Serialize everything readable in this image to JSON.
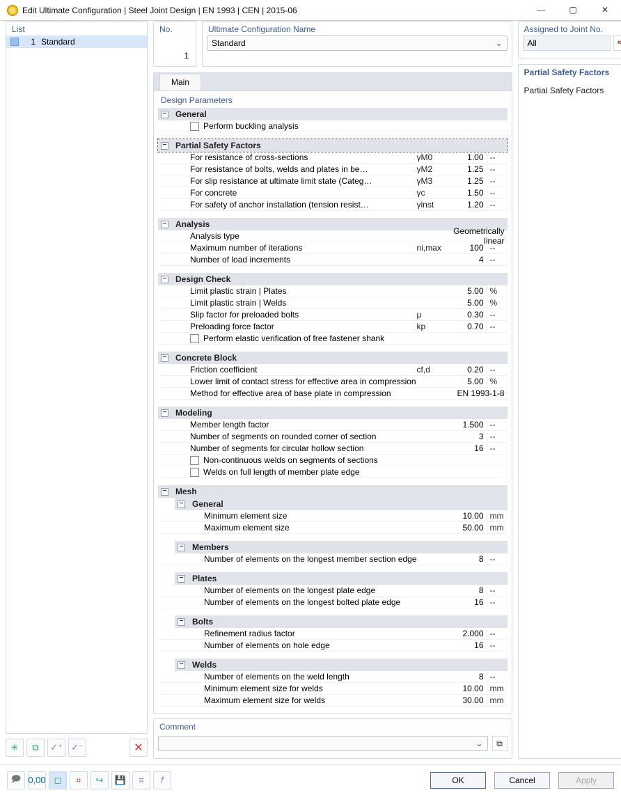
{
  "window": {
    "title": "Edit Ultimate Configuration | Steel Joint Design | EN 1993 | CEN | 2015-06"
  },
  "sidebar": {
    "header": "List",
    "items": [
      {
        "index": "1",
        "name": "Standard"
      }
    ]
  },
  "top": {
    "no_label": "No.",
    "no_value": "1",
    "name_label": "Ultimate Configuration Name",
    "name_value": "Standard",
    "assigned_label": "Assigned to Joint No.",
    "assigned_value": "All"
  },
  "tabs": {
    "main": "Main"
  },
  "designparams_label": "Design Parameters",
  "general": {
    "header": "General",
    "buckling": "Perform buckling analysis"
  },
  "psf": {
    "header": "Partial Safety Factors",
    "rows": [
      {
        "lbl": "For resistance of cross-sections",
        "sym": "γM0",
        "val": "1.00",
        "unit": "--"
      },
      {
        "lbl": "For resistance of bolts, welds and plates in be…",
        "sym": "γM2",
        "val": "1.25",
        "unit": "--"
      },
      {
        "lbl": "For slip resistance at ultimate limit state (Categ…",
        "sym": "γM3",
        "val": "1.25",
        "unit": "--"
      },
      {
        "lbl": "For concrete",
        "sym": "γc",
        "val": "1.50",
        "unit": "--"
      },
      {
        "lbl": "For safety of anchor installation (tension resist…",
        "sym": "γinst",
        "val": "1.20",
        "unit": "--"
      }
    ]
  },
  "analysis": {
    "header": "Analysis",
    "rows": [
      {
        "lbl": "Analysis type",
        "sym": "",
        "val": "",
        "wide": "Geometrically linear"
      },
      {
        "lbl": "Maximum number of iterations",
        "sym": "ni,max",
        "val": "100",
        "unit": "--"
      },
      {
        "lbl": "Number of load increments",
        "sym": "",
        "val": "4",
        "unit": "--"
      }
    ]
  },
  "designcheck": {
    "header": "Design Check",
    "rows": [
      {
        "lbl": "Limit plastic strain | Plates",
        "sym": "",
        "val": "5.00",
        "unit": "%"
      },
      {
        "lbl": "Limit plastic strain | Welds",
        "sym": "",
        "val": "5.00",
        "unit": "%"
      },
      {
        "lbl": "Slip factor for preloaded bolts",
        "sym": "μ",
        "val": "0.30",
        "unit": "--"
      },
      {
        "lbl": "Preloading force factor",
        "sym": "kp",
        "val": "0.70",
        "unit": "--"
      }
    ],
    "elastic_check": "Perform elastic verification of free fastener shank"
  },
  "concrete": {
    "header": "Concrete Block",
    "rows": [
      {
        "lbl": "Friction coefficient",
        "sym": "cf,d",
        "val": "0.20",
        "unit": "--"
      },
      {
        "lbl": "Lower limit of contact stress for effective area in compression",
        "sym": "",
        "val": "5.00",
        "unit": "%"
      },
      {
        "lbl": "Method for effective area of base plate in compression",
        "sym": "",
        "val": "",
        "wide": "EN 1993-1-8"
      }
    ]
  },
  "modeling": {
    "header": "Modeling",
    "rows": [
      {
        "lbl": "Member length factor",
        "sym": "",
        "val": "1.500",
        "unit": "--"
      },
      {
        "lbl": "Number of segments on rounded corner of section",
        "sym": "",
        "val": "3",
        "unit": "--"
      },
      {
        "lbl": "Number of segments for circular hollow section",
        "sym": "",
        "val": "16",
        "unit": "--"
      }
    ],
    "check1": "Non-continuous welds on segments of sections",
    "check2": "Welds on full length of member plate edge"
  },
  "mesh": {
    "header": "Mesh",
    "general": {
      "header": "General",
      "rows": [
        {
          "lbl": "Minimum element size",
          "val": "10.00",
          "unit": "mm"
        },
        {
          "lbl": "Maximum element size",
          "val": "50.00",
          "unit": "mm"
        }
      ]
    },
    "members": {
      "header": "Members",
      "rows": [
        {
          "lbl": "Number of elements on the longest member section edge",
          "val": "8",
          "unit": "--"
        }
      ]
    },
    "plates": {
      "header": "Plates",
      "rows": [
        {
          "lbl": "Number of elements on the longest plate edge",
          "val": "8",
          "unit": "--"
        },
        {
          "lbl": "Number of elements on the longest bolted plate edge",
          "val": "16",
          "unit": "--"
        }
      ]
    },
    "bolts": {
      "header": "Bolts",
      "rows": [
        {
          "lbl": "Refinement radius factor",
          "val": "2.000",
          "unit": "--"
        },
        {
          "lbl": "Number of elements on hole edge",
          "val": "16",
          "unit": "--"
        }
      ]
    },
    "welds": {
      "header": "Welds",
      "rows": [
        {
          "lbl": "Number of elements on the weld length",
          "val": "8",
          "unit": "--"
        },
        {
          "lbl": "Minimum element size for welds",
          "val": "10.00",
          "unit": "mm"
        },
        {
          "lbl": "Maximum element size for welds",
          "val": "30.00",
          "unit": "mm"
        }
      ]
    }
  },
  "right": {
    "header": "Partial Safety Factors",
    "body": "Partial Safety Factors"
  },
  "comment": {
    "header": "Comment"
  },
  "buttons": {
    "ok": "OK",
    "cancel": "Cancel",
    "apply": "Apply"
  }
}
